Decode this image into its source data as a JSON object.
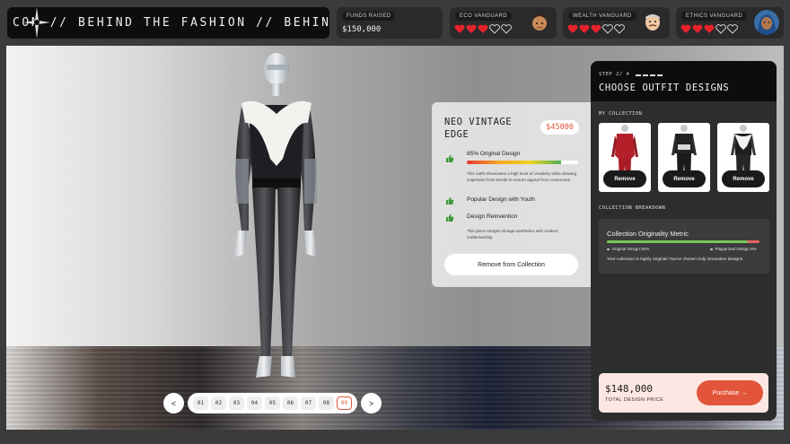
{
  "marquee": {
    "text": "CON // BEHIND THE FASHION // BEHIND THE F"
  },
  "funds": {
    "label": "FUNDS RAISED",
    "value": "$150,000"
  },
  "vanguards": [
    {
      "label": "ECO VANGUARD",
      "hearts_filled": 3,
      "hearts_total": 5,
      "avatar": "eco-avatar"
    },
    {
      "label": "WEALTH VANGUARD",
      "hearts_filled": 3,
      "hearts_total": 5,
      "avatar": "wealth-avatar"
    },
    {
      "label": "ETHICS VANGUARD",
      "hearts_filled": 3,
      "hearts_total": 5,
      "avatar": "ethics-avatar"
    }
  ],
  "pager": {
    "prev": "<",
    "next": ">",
    "pages": [
      "01",
      "02",
      "03",
      "04",
      "05",
      "06",
      "07",
      "08",
      "09"
    ],
    "active": "09"
  },
  "design": {
    "title": "NEO VINTAGE EDGE",
    "price": "$45000",
    "rows": [
      {
        "icon": "thumbs-up-icon",
        "title": "85% Original Design",
        "meter": 0.85,
        "desc": "This outfit showcases a high level of creativity while drawing inspiration from trends to ensure appeal from consumers"
      },
      {
        "icon": "thumbs-up-icon",
        "title": "Popular Design with Youth"
      },
      {
        "icon": "thumbs-up-icon",
        "title": "Design Reinvention",
        "desc": "This piece merges vintage aesthetics with modern craftsmanship"
      }
    ],
    "remove_label": "Remove from Collection"
  },
  "panel": {
    "step": "STEP 2/ 4",
    "title": "CHOOSE OUTFIT DESIGNS",
    "collection_label": "MY COLLECTION",
    "thumb_remove": "Remove",
    "breakdown_label": "COLLECTION BREAKDOWN",
    "metric": {
      "title": "Collection Originality Metric",
      "original": "Original Design 92%",
      "plagiarized": "Plagiarized Design 8%",
      "original_share": 0.92,
      "note": "Your collection is highly original! You've chosen truly innovative designs."
    },
    "total": {
      "value": "$148,000",
      "label": "TOTAL DESIGN PRICE"
    },
    "purchase": "Purchase →"
  },
  "colors": {
    "accent": "#e2553a",
    "heart": "#e8222a",
    "panel_dark": "#0d0d0d"
  }
}
